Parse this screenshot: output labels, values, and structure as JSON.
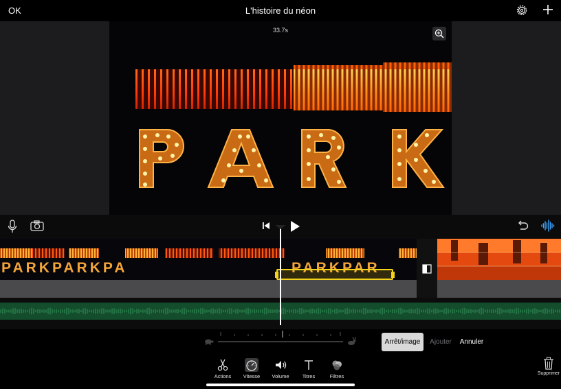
{
  "topbar": {
    "ok_label": "OK",
    "title": "L'histoire du néon",
    "settings_icon": "gear-icon",
    "add_icon": "plus-icon"
  },
  "viewer": {
    "timecode": "33.7s",
    "zoom_icon": "zoom-in-icon",
    "preview_sign_text": "PARK"
  },
  "toolstrip": {
    "mic_icon": "microphone-icon",
    "camera_icon": "camera-icon",
    "skip_icon": "skip-to-start-icon",
    "play_icon": "play-icon",
    "undo_icon": "undo-icon",
    "waveform_icon": "audio-waveform-icon"
  },
  "timeline": {
    "clip1_text": "PARKPARKPA",
    "clip1_text_b": "PARKPAR",
    "transition_icon": "transition-icon",
    "accent_color": "#f2d21b",
    "audio_color": "#134d2c"
  },
  "speed_controls": {
    "slow_icon": "turtle-icon",
    "fast_icon": "hare-icon",
    "freeze_label": "Arrêt/image",
    "add_label": "Ajouter",
    "cancel_label": "Annuler"
  },
  "tools": [
    {
      "label": "Actions",
      "icon": "scissors-icon"
    },
    {
      "label": "Vitesse",
      "icon": "speedometer-icon"
    },
    {
      "label": "Volume",
      "icon": "speaker-icon"
    },
    {
      "label": "Titres",
      "icon": "text-icon"
    },
    {
      "label": "Filtres",
      "icon": "filters-icon"
    }
  ],
  "delete_label": "Supprimer"
}
